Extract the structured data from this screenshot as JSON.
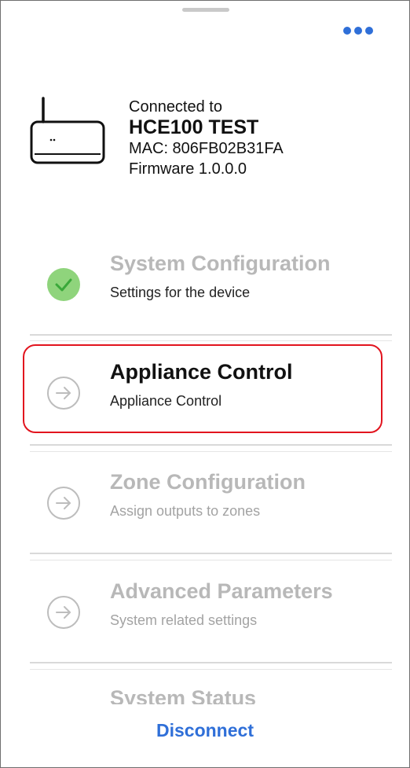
{
  "device": {
    "connected_label": "Connected to",
    "name": "HCE100 TEST",
    "mac": "MAC: 806FB02B31FA",
    "firmware": "Firmware 1.0.0.0"
  },
  "menu": [
    {
      "title": "System Configuration",
      "subtitle": "Settings for the device",
      "state": "done"
    },
    {
      "title": "Appliance Control",
      "subtitle": "Appliance Control",
      "state": "active"
    },
    {
      "title": "Zone Configuration",
      "subtitle": "Assign outputs to zones",
      "state": "disabled"
    },
    {
      "title": "Advanced Parameters",
      "subtitle": "System related settings",
      "state": "disabled"
    },
    {
      "title": "System Status",
      "subtitle": "",
      "state": "disabled"
    }
  ],
  "footer": {
    "disconnect_label": "Disconnect"
  },
  "colors": {
    "accent": "#2f6fd8",
    "highlight": "#e2141e",
    "check": "#8fd47c"
  },
  "icons": {
    "more": "more-horizontal-icon",
    "device": "router-icon",
    "check": "check-circle-icon",
    "arrow": "arrow-right-circle-icon"
  }
}
